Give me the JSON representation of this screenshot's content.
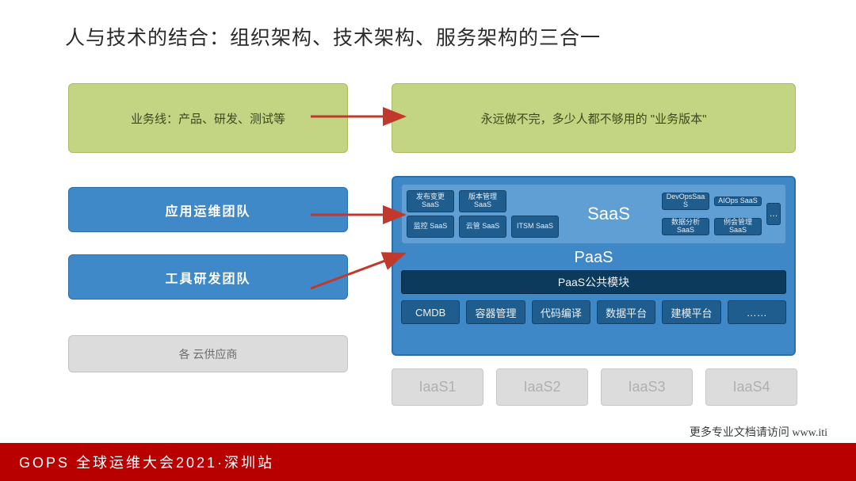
{
  "title": "人与技术的结合：组织架构、技术架构、服务架构的三合一",
  "left": {
    "business_line": "业务线：产品、研发、测试等",
    "ops_team": "应用运维团队",
    "tool_team": "工具研发团队",
    "cloud_vendors": "各 云供应商"
  },
  "right": {
    "business_version": "永远做不完，多少人都不够用的 \"业务版本\""
  },
  "stack": {
    "saas_label": "SaaS",
    "saas_left": [
      "发布变更\nSaaS",
      "版本管理\nSaaS",
      "",
      "监控\nSaaS",
      "云管\nSaaS",
      "ITSM\nSaaS"
    ],
    "saas_right": [
      "DevOpsSaa\nS",
      "AIOps\nSaaS",
      "数据分析\nSaaS",
      "例会管理\nSaaS"
    ],
    "saas_more": "…",
    "paas_label": "PaaS",
    "paas_bar": "PaaS公共模块",
    "paas_mods": [
      "CMDB",
      "容器管理",
      "代码编译",
      "数据平台",
      "建模平台",
      "……"
    ]
  },
  "iaas": [
    "IaaS1",
    "IaaS2",
    "IaaS3",
    "IaaS4"
  ],
  "footer": "GOPS 全球运维大会2021·深圳站",
  "footer_note": "更多专业文档请访问 www.iti"
}
